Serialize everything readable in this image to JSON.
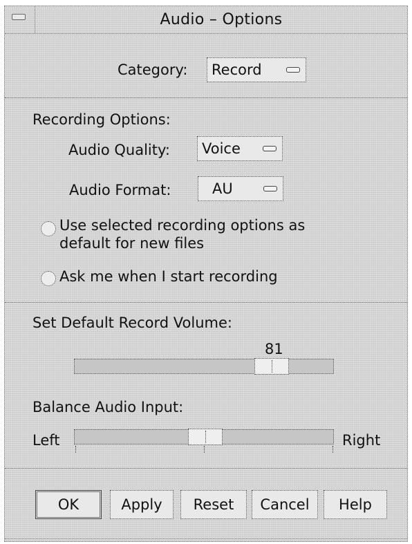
{
  "window": {
    "title": "Audio – Options"
  },
  "category": {
    "label": "Category:",
    "value": "Record"
  },
  "recording": {
    "heading": "Recording Options:",
    "quality_label": "Audio Quality:",
    "quality_value": "Voice",
    "format_label": "Audio Format:",
    "format_value": "AU",
    "radio_default_line1": "Use selected recording options as",
    "radio_default_line2": "default for new files",
    "radio_ask": "Ask me when I start recording"
  },
  "volume": {
    "heading": "Set Default Record Volume:",
    "value": "81",
    "level": 81
  },
  "balance": {
    "heading": "Balance Audio Input:",
    "left_label": "Left",
    "right_label": "Right"
  },
  "buttons": {
    "ok": "OK",
    "apply": "Apply",
    "reset": "Reset",
    "cancel": "Cancel",
    "help": "Help"
  },
  "icons": {
    "window_menu": "window-menu-icon",
    "option_menu": "option-menu-icon"
  }
}
